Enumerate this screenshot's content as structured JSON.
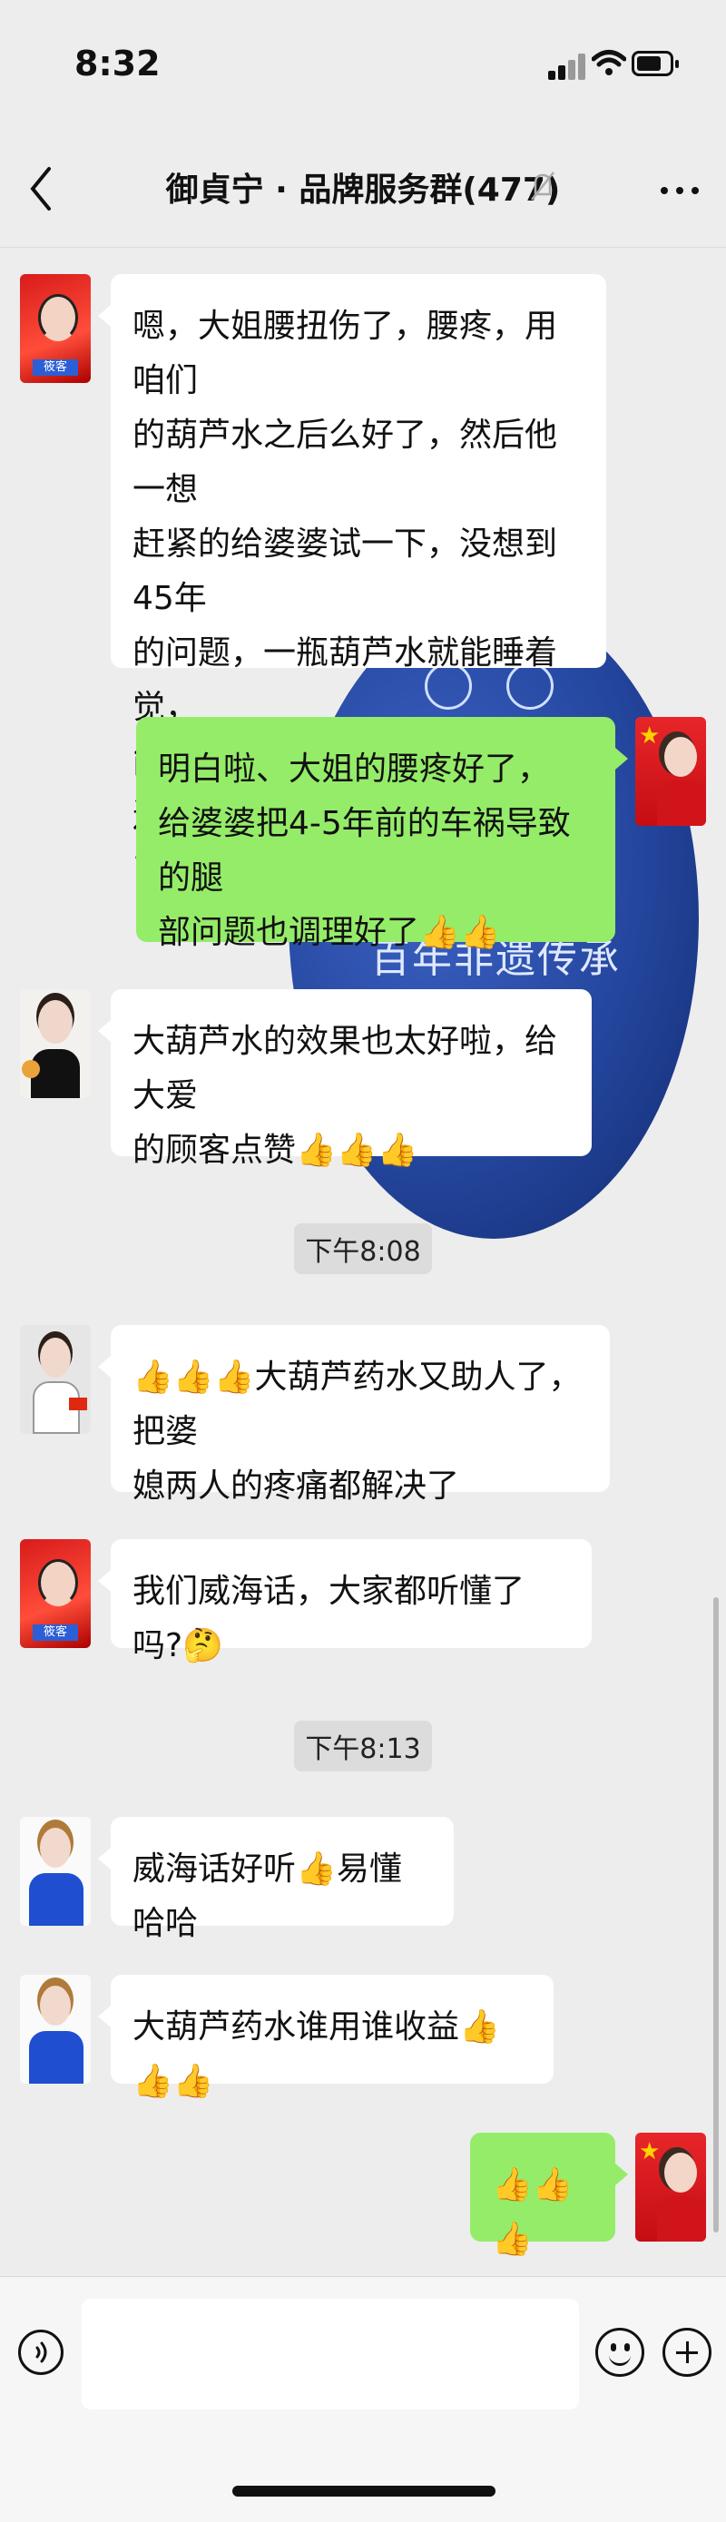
{
  "status_bar": {
    "time": "8:32"
  },
  "nav": {
    "title": "御貞宁 · 品牌服务群(477)"
  },
  "background": {
    "logo_text": "百年非遗传承"
  },
  "messages": [
    {
      "side": "left",
      "avatar": "red-portrait",
      "text": "嗯，大姐腰扭伤了，腰疼，用咱们\n的葫芦水之后么好了，然后他一想\n赶紧的给婆婆试一下，没想到45年\n的问题，一瓶葫芦水就能睡着觉，\n能走路了，这又赶紧的给婆婆送去\n了一瓶"
    },
    {
      "side": "right",
      "avatar": "flag-portrait",
      "text": "明白啦、大姐的腰疼好了，\n给婆婆把4-5年前的车祸导致的腿\n部问题也调理好了👍👍"
    },
    {
      "side": "left",
      "avatar": "white-portrait",
      "text": "大葫芦水的效果也太好啦，给大爱\n的顾客点赞👍👍👍"
    },
    {
      "side": "left",
      "avatar": "suit-portrait",
      "text": "👍👍👍大葫芦药水又助人了，把婆\n媳两人的疼痛都解决了"
    },
    {
      "side": "left",
      "avatar": "red-portrait",
      "text": "我们威海话，大家都听懂了吗?🤔"
    },
    {
      "side": "left",
      "avatar": "blue-portrait",
      "text": "威海话好听👍易懂哈哈"
    },
    {
      "side": "left",
      "avatar": "blue-portrait",
      "text": "大葫芦药水谁用谁收益👍👍👍"
    },
    {
      "side": "right",
      "avatar": "flag-portrait",
      "text": "👍👍👍"
    }
  ],
  "timestamps": [
    "下午8:08",
    "下午8:13"
  ],
  "input": {
    "placeholder": ""
  }
}
